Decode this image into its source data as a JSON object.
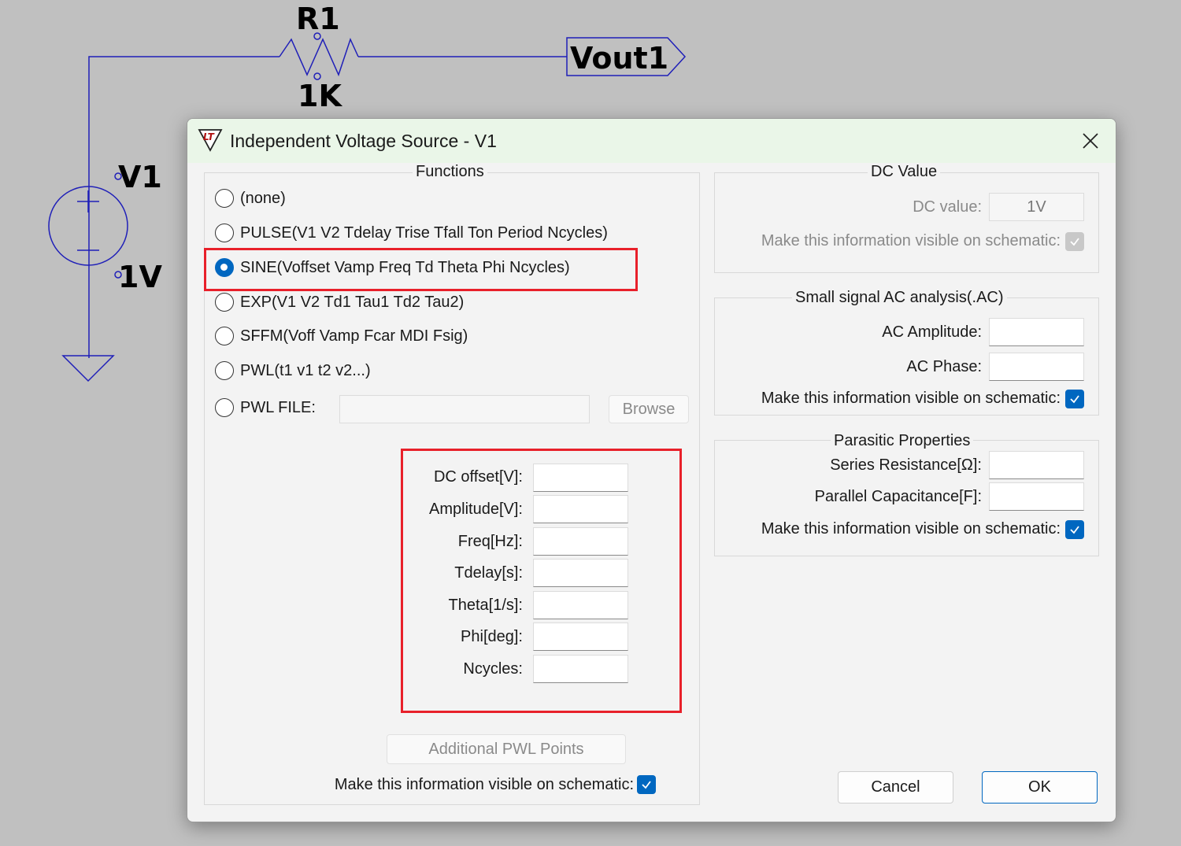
{
  "schematic": {
    "resistor_ref": "R1",
    "resistor_value": "1K",
    "net_label": "Vout1",
    "source_ref": "V1",
    "source_value": "1V"
  },
  "dialog": {
    "title": "Independent Voltage Source - V1",
    "functions": {
      "title": "Functions",
      "options": [
        {
          "label": "(none)",
          "selected": false
        },
        {
          "label": "PULSE(V1 V2 Tdelay Trise Tfall Ton Period Ncycles)",
          "selected": false
        },
        {
          "label": "SINE(Voffset Vamp Freq Td Theta Phi Ncycles)",
          "selected": true
        },
        {
          "label": "EXP(V1 V2 Td1 Tau1 Td2 Tau2)",
          "selected": false
        },
        {
          "label": "SFFM(Voff Vamp Fcar MDI Fsig)",
          "selected": false
        },
        {
          "label": "PWL(t1 v1 t2 v2...)",
          "selected": false
        },
        {
          "label": "PWL FILE:",
          "selected": false
        }
      ],
      "browse_label": "Browse",
      "params": [
        {
          "label": "DC offset[V]:",
          "value": ""
        },
        {
          "label": "Amplitude[V]:",
          "value": ""
        },
        {
          "label": "Freq[Hz]:",
          "value": ""
        },
        {
          "label": "Tdelay[s]:",
          "value": ""
        },
        {
          "label": "Theta[1/s]:",
          "value": ""
        },
        {
          "label": "Phi[deg]:",
          "value": ""
        },
        {
          "label": "Ncycles:",
          "value": ""
        }
      ],
      "additional_pwl_label": "Additional PWL Points",
      "visible_label": "Make this information visible on schematic:",
      "visible_checked": true
    },
    "dc_value": {
      "title": "DC Value",
      "label": "DC value:",
      "value": "1V",
      "visible_label": "Make this information visible on schematic:",
      "visible_checked": true,
      "disabled": true
    },
    "ac": {
      "title": "Small signal AC analysis(.AC)",
      "amplitude_label": "AC Amplitude:",
      "amplitude_value": "",
      "phase_label": "AC Phase:",
      "phase_value": "",
      "visible_label": "Make this information visible on schematic:",
      "visible_checked": true
    },
    "parasitic": {
      "title": "Parasitic Properties",
      "series_label": "Series Resistance[Ω]:",
      "series_value": "",
      "parallel_label": "Parallel Capacitance[F]:",
      "parallel_value": "",
      "visible_label": "Make this information visible on schematic:",
      "visible_checked": true
    },
    "cancel_label": "Cancel",
    "ok_label": "OK"
  },
  "colors": {
    "accent": "#0067c0",
    "highlight": "#e8202a",
    "wire": "#1f1fb8",
    "titlebar": "#eaf6e8"
  }
}
